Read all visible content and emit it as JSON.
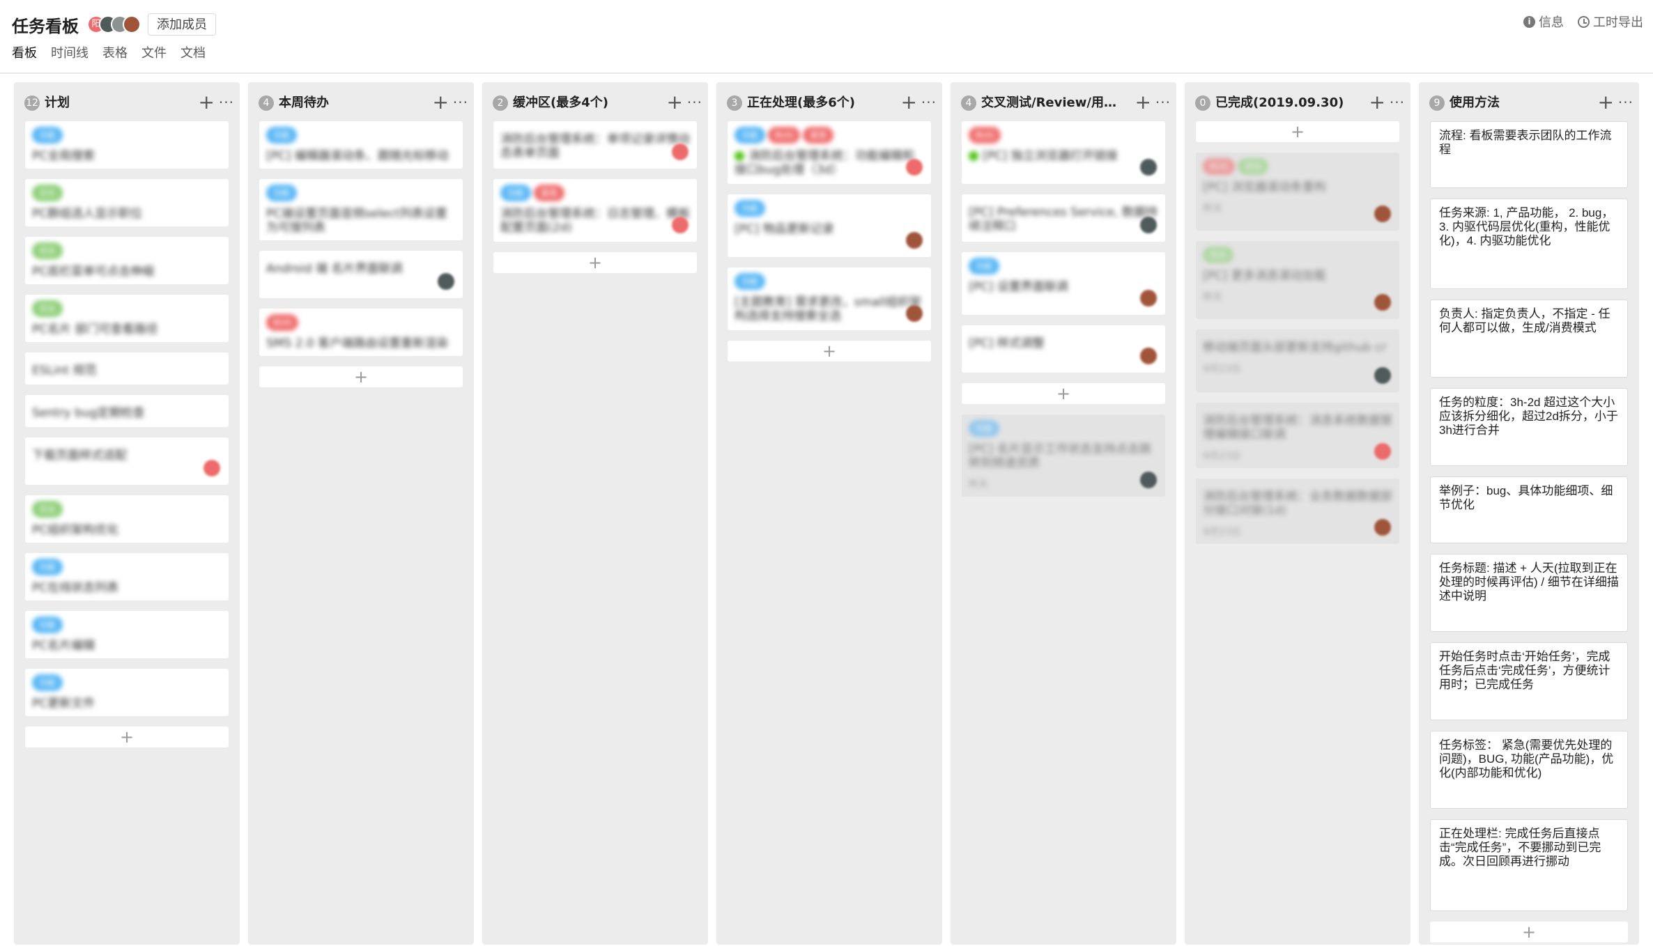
{
  "header": {
    "title": "任务看板",
    "avatars": [
      {
        "initial": "阳",
        "color": "#ee6b6b"
      },
      {
        "initial": "",
        "color": "#4f5b5a"
      },
      {
        "initial": "",
        "color": "#8a9391"
      },
      {
        "initial": "",
        "color": "#a0553a"
      }
    ],
    "add_member_label": "添加成员",
    "info_label": "信息",
    "export_label": "工时导出"
  },
  "tabs": [
    "看板",
    "时间线",
    "表格",
    "文件",
    "文档"
  ],
  "active_tab": "看板",
  "colors": {
    "tag_blue": "#5bb8f5",
    "tag_green": "#8fd07a",
    "tag_red": "#f07070",
    "column_bg": "#ececec",
    "avatar_red": "#ee6b6b",
    "avatar_dark": "#4f5b5a",
    "avatar_brown": "#a0553a"
  },
  "columns": [
    {
      "id": "plan",
      "count": "12",
      "title": "计划",
      "cards": [
        {
          "tags": [
            {
              "label": "功能",
              "color": "#5bb8f5"
            }
          ],
          "title": "PC全局搜索"
        },
        {
          "tags": [
            {
              "label": "优化",
              "color": "#8fd07a"
            }
          ],
          "title": "PC群组选人显示职位"
        },
        {
          "tags": [
            {
              "label": "优化",
              "color": "#8fd07a"
            }
          ],
          "title": "PC底栏菜单可点击伸缩"
        },
        {
          "tags": [
            {
              "label": "优化",
              "color": "#8fd07a"
            }
          ],
          "title": "PC名片 部门可查看路径"
        },
        {
          "tags": [],
          "title": "ESLint 规范"
        },
        {
          "tags": [],
          "title": "Sentry bug定期检查"
        },
        {
          "tags": [],
          "title": "下载页面样式适配",
          "avatar": "#ee6b6b"
        },
        {
          "tags": [
            {
              "label": "优化",
              "color": "#8fd07a"
            }
          ],
          "title": "PC组织架构优化"
        },
        {
          "tags": [
            {
              "label": "功能",
              "color": "#5bb8f5"
            }
          ],
          "title": "PC在线状态列表"
        },
        {
          "tags": [
            {
              "label": "功能",
              "color": "#5bb8f5"
            }
          ],
          "title": "PC名片编辑"
        },
        {
          "tags": [
            {
              "label": "功能",
              "color": "#5bb8f5"
            }
          ],
          "title": "PC更新文件"
        }
      ]
    },
    {
      "id": "week",
      "count": "4",
      "title": "本周待办",
      "cards": [
        {
          "tags": [
            {
              "label": "功能",
              "color": "#5bb8f5"
            }
          ],
          "title": "[PC] 编辑器滚动条、跟随光标移动"
        },
        {
          "tags": [
            {
              "label": "功能",
              "color": "#5bb8f5"
            }
          ],
          "title": "PC端设置页面音频select列表设置为可搜列表"
        },
        {
          "tags": [],
          "title": "Android 端 名片界面联调",
          "avatar": "#4f5b5a"
        },
        {
          "tags": [
            {
              "label": "BUG",
              "color": "#f07070"
            }
          ],
          "title": "SMS 2.0 客户端路由设置重新渲染"
        }
      ]
    },
    {
      "id": "buffer",
      "count": "2",
      "title": "缓冲区(最多4个)",
      "cards": [
        {
          "tags": [],
          "title": "消防后台管理系统：单项记录详情动态表单页面",
          "avatar": "#ee6b6b"
        },
        {
          "tags": [
            {
              "label": "功能",
              "color": "#5bb8f5"
            },
            {
              "label": "紧急",
              "color": "#f07070"
            }
          ],
          "title": "消防后台管理系统：日志管理、模板配置页面(2d)",
          "avatar": "#ee6b6b"
        }
      ]
    },
    {
      "id": "doing",
      "count": "3",
      "title": "正在处理(最多6个)",
      "cards": [
        {
          "tags": [
            {
              "label": "功能",
              "color": "#5bb8f5"
            },
            {
              "label": "BUG",
              "color": "#f07070"
            },
            {
              "label": "紧急",
              "color": "#f07070"
            }
          ],
          "title": "消防后台管理系统：功能编辑和接口bug处理（3d）",
          "green": true,
          "avatar": "#ee6b6b"
        },
        {
          "tags": [
            {
              "label": "功能",
              "color": "#5bb8f5"
            }
          ],
          "title": "[PC] 物品更新记录",
          "avatar": "#a0553a"
        },
        {
          "tags": [
            {
              "label": "功能",
              "color": "#5bb8f5"
            }
          ],
          "title": "[主题教育] 需求更改，small组织架构选择支持搜索全选",
          "avatar": "#a0553a"
        }
      ]
    },
    {
      "id": "review",
      "count": "4",
      "title": "交叉测试/Review/用户验收",
      "cards": [
        {
          "tags": [
            {
              "label": "BUG",
              "color": "#f07070"
            }
          ],
          "title": "[PC] 独立浏览器打开链接",
          "green": true,
          "avatar": "#4f5b5a"
        },
        {
          "tags": [],
          "title": "[PC] Preferences Service, 数据持续注释口",
          "avatar": "#4f5b5a"
        },
        {
          "tags": [
            {
              "label": "功能",
              "color": "#5bb8f5"
            }
          ],
          "title": "[PC] 设置界面联调",
          "avatar": "#a0553a"
        },
        {
          "tags": [],
          "title": "[PC] 样式调整",
          "avatar": "#a0553a"
        }
      ],
      "done_cards": [
        {
          "tags": [
            {
              "label": "功能",
              "color": "#5bb8f5"
            }
          ],
          "title": "[PC] 名片显示工作状态支持点击跳转到频道资质",
          "meta": "昨天",
          "avatar": "#4f5b5a"
        }
      ]
    },
    {
      "id": "done",
      "count": "0",
      "title": "已完成(2019.09.30)",
      "cards": [],
      "done_cards": [
        {
          "tags": [
            {
              "label": "BUG",
              "color": "#f07070"
            },
            {
              "label": "优化",
              "color": "#8fd07a"
            }
          ],
          "title": "[PC] 浏览器滚动条重构",
          "meta": "昨天",
          "avatar": "#a0553a"
        },
        {
          "tags": [
            {
              "label": "优化",
              "color": "#8fd07a"
            }
          ],
          "title": "[PC] 更多消息滚动加载",
          "meta": "昨天",
          "avatar": "#a0553a"
        },
        {
          "tags": [],
          "title": "移动端页面头部更新支持github cr",
          "meta": "9月23日",
          "avatar": "#4f5b5a"
        },
        {
          "tags": [],
          "title": "消防后台管理系统：消息系统数据管理编辑接口联调",
          "meta": "9月23日",
          "avatar": "#ee6b6b"
        },
        {
          "tags": [],
          "title": "消防后台管理系统：业务数据数据部分接口对接(1d)",
          "meta": "9月23日",
          "avatar": "#a0553a"
        }
      ]
    },
    {
      "id": "usage",
      "count": "9",
      "title": "使用方法",
      "notes": [
        "流程: 看板需要表示团队的工作流程",
        "任务来源: 1, 产品功能， 2. bug， 3. 内驱代码层优化(重构，性能优化)，4. 内驱功能优化",
        "负责人: 指定负责人，不指定 - 任何人都可以做，生成/消费模式",
        "任务的粒度：3h-2d 超过这个大小应该拆分细化，超过2d拆分，小于3h进行合并",
        "举例子：bug、具体功能细项、细节优化",
        "任务标题: 描述 + 人天(拉取到正在处理的时候再评估) / 细节在详细描述中说明",
        "开始任务时点击‘开始任务’，完成任务后点击‘完成任务’，方便统计用时；已完成任务",
        "任务标签： 紧急(需要优先处理的问题)，BUG, 功能(产品功能)，优化(内部功能和优化)",
        "正在处理栏: 完成任务后直接点击“完成任务”，不要挪动到已完成。次日回顾再进行挪动"
      ]
    }
  ]
}
